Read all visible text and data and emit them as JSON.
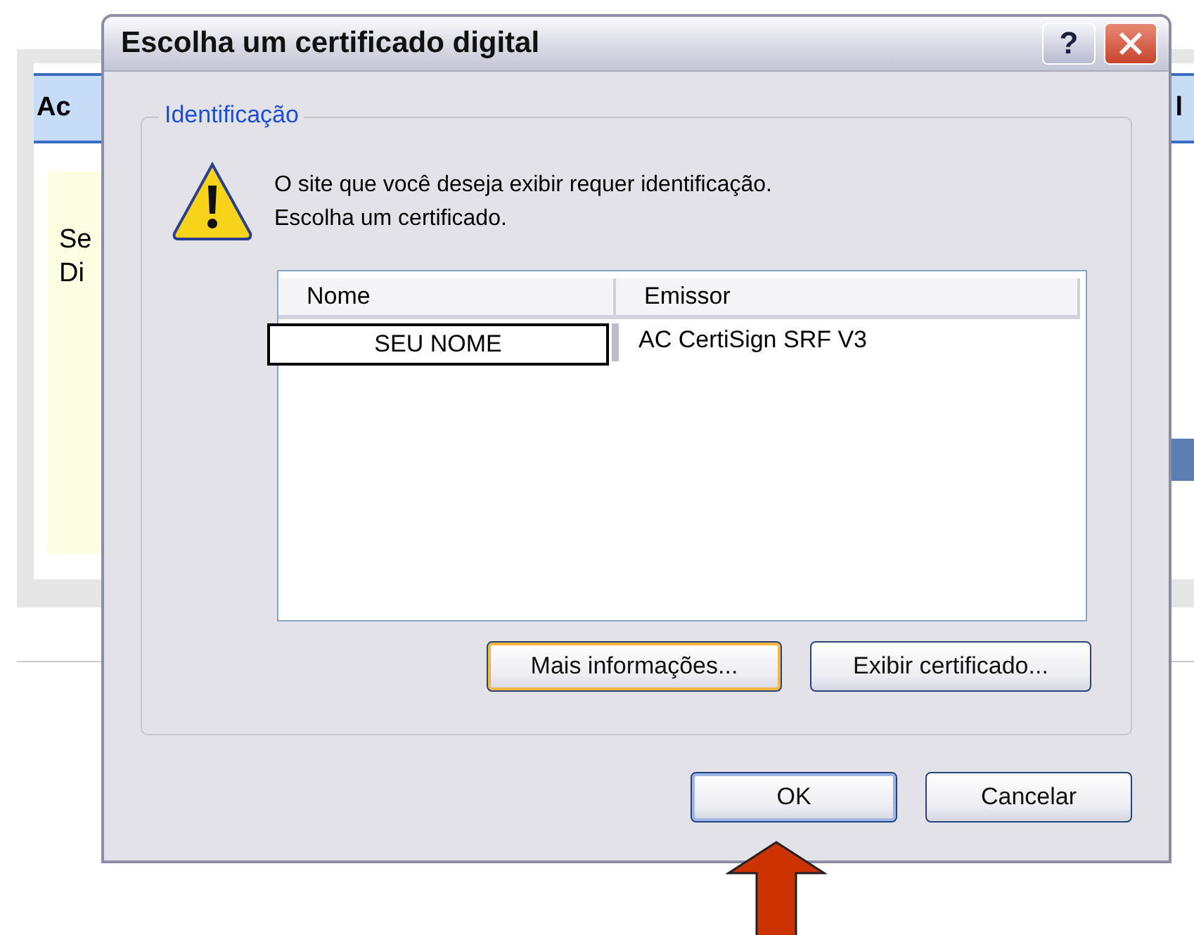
{
  "background_page": {
    "header_left": "Ac",
    "header_right": "l",
    "panel_lines": [
      "Se",
      "Di"
    ]
  },
  "dialog": {
    "title": "Escolha um certificado digital",
    "help_button": "?",
    "group": {
      "legend": "Identificação",
      "message_lines": [
        "O site que você deseja exibir requer identificação.",
        "Escolha um certificado."
      ],
      "table": {
        "columns": [
          "Nome",
          "Emissor"
        ],
        "rows": [
          {
            "name": "SEU NOME",
            "issuer": "AC CertiSign SRF V3",
            "selected": true
          }
        ]
      },
      "buttons": [
        {
          "label": "Mais informações...",
          "focused": true
        },
        {
          "label": "Exibir certificado...",
          "focused": false
        }
      ]
    },
    "buttons": [
      {
        "label": "OK",
        "default": true
      },
      {
        "label": "Cancelar",
        "default": false
      }
    ]
  }
}
